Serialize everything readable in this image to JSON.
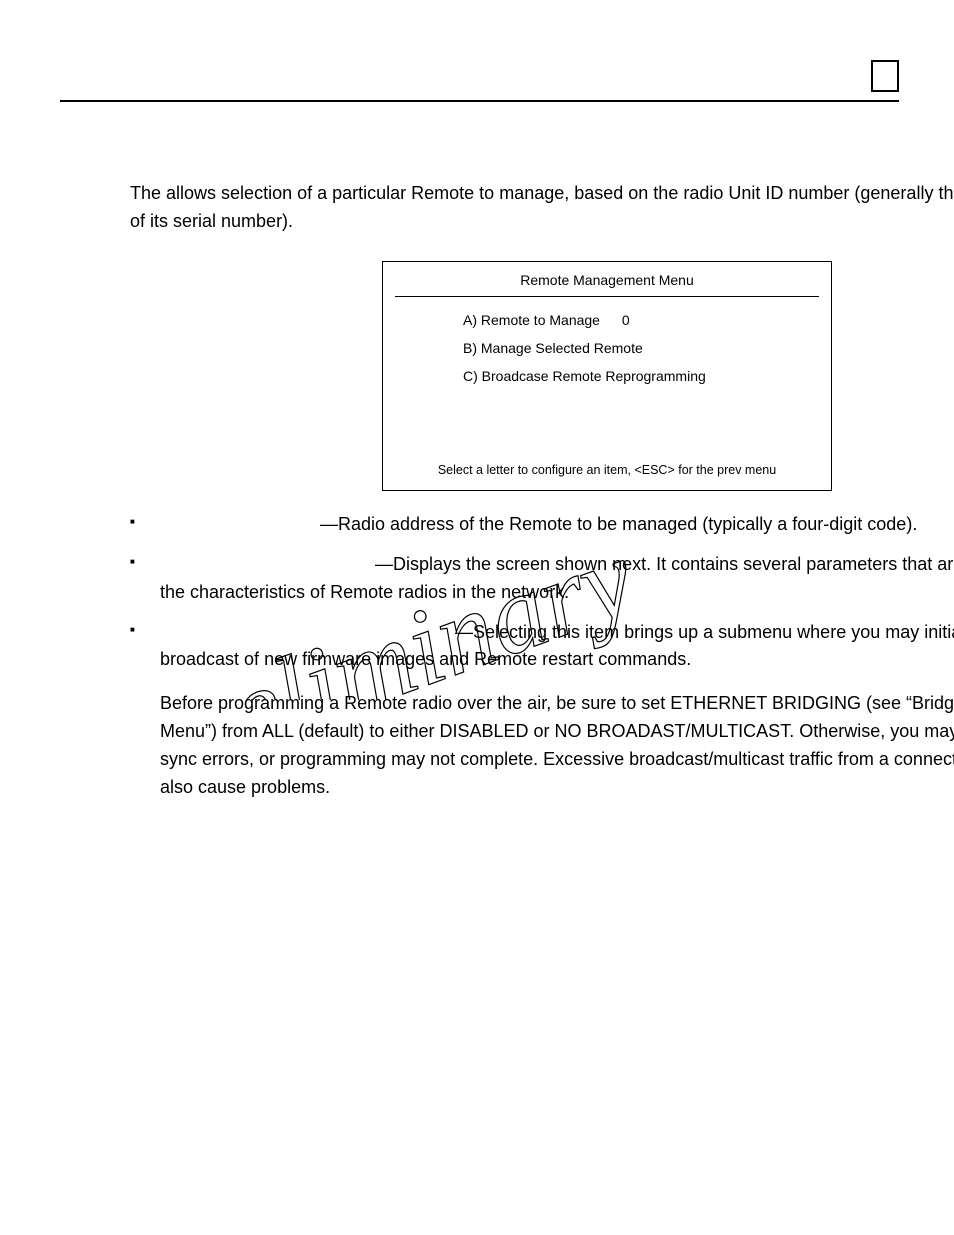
{
  "intro": {
    "pre": "The ",
    "post": " allows selection of a particular Remote to manage, based on the radio Unit ID number (generally the last four digits of its serial number)."
  },
  "menu": {
    "title": "Remote Management Menu",
    "items": [
      {
        "label": "A) Remote to Manage",
        "value": "0"
      },
      {
        "label": "B) Manage Selected Remote",
        "value": ""
      },
      {
        "label": "C) Broadcase Remote Reprogramming",
        "value": ""
      }
    ],
    "footer": "Select a letter to configure an item, <ESC> for the prev menu"
  },
  "bullets": [
    {
      "lead": "",
      "text": "—Radio address of the Remote to be managed (typically a four-digit code)."
    },
    {
      "lead": "",
      "text": "—Displays the screen shown next. It contains several parameters that are used to set the characteristics of Remote radios in the network."
    },
    {
      "lead": "",
      "text": "—Selecting this item brings up a submenu where you may initiate the broadcast of new firmware images and Remote restart commands."
    }
  ],
  "note": "Before programming a Remote radio over the air, be sure to set ETHERNET BRIDGING (see “Bridge Configuration Menu”) from ALL (default) to either DISABLED or NO BROADAST/MULTICAST. Otherwise, you may experience sync errors, or programming may not complete. Excessive broadcast/multicast traffic from a connected LAN can also cause problems.",
  "watermark": "Preliminary"
}
